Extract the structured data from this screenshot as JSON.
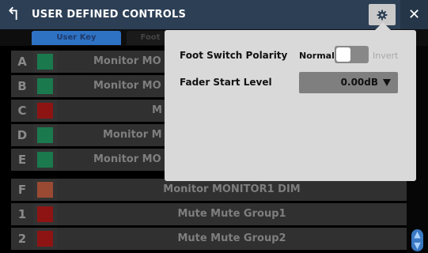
{
  "title": "USER DEFINED CONTROLS",
  "tabs": [
    {
      "label": "User Key"
    },
    {
      "label": "Foot"
    }
  ],
  "rows": [
    {
      "key": "A",
      "color": "#1a7a4e",
      "function": "Monitor MO"
    },
    {
      "key": "B",
      "color": "#1a7a4e",
      "function": "Monitor MO"
    },
    {
      "key": "C",
      "color": "#8e1414",
      "function": "M"
    },
    {
      "key": "D",
      "color": "#1a7a4e",
      "function": "Monitor M"
    },
    {
      "key": "E",
      "color": "#1a7a4e",
      "function": "Monitor MO"
    },
    {
      "key": "F",
      "color": "#9a4a33",
      "function": "Monitor MONITOR1 DIM"
    },
    {
      "key": "1",
      "color": "#8e1414",
      "function": "Mute Mute Group1"
    },
    {
      "key": "2",
      "color": "#8e1414",
      "function": "Mute Mute Group2"
    }
  ],
  "popup": {
    "foot_switch_polarity": {
      "label": "Foot Switch Polarity",
      "option_normal": "Normal",
      "option_invert": "Invert",
      "selected": "Normal"
    },
    "fader_start_level": {
      "label": "Fader Start Level",
      "value": "0.00dB"
    }
  },
  "colors": {
    "titlebar": "#2c3f55",
    "tab_active": "#2e72c4",
    "popup_bg": "#d9d9d9",
    "row_bg": "#303030"
  },
  "icons": {
    "back": "back-arrow-icon",
    "settings": "gear-icon",
    "close": "close-icon",
    "scroll": "scroll-updown-icon"
  }
}
